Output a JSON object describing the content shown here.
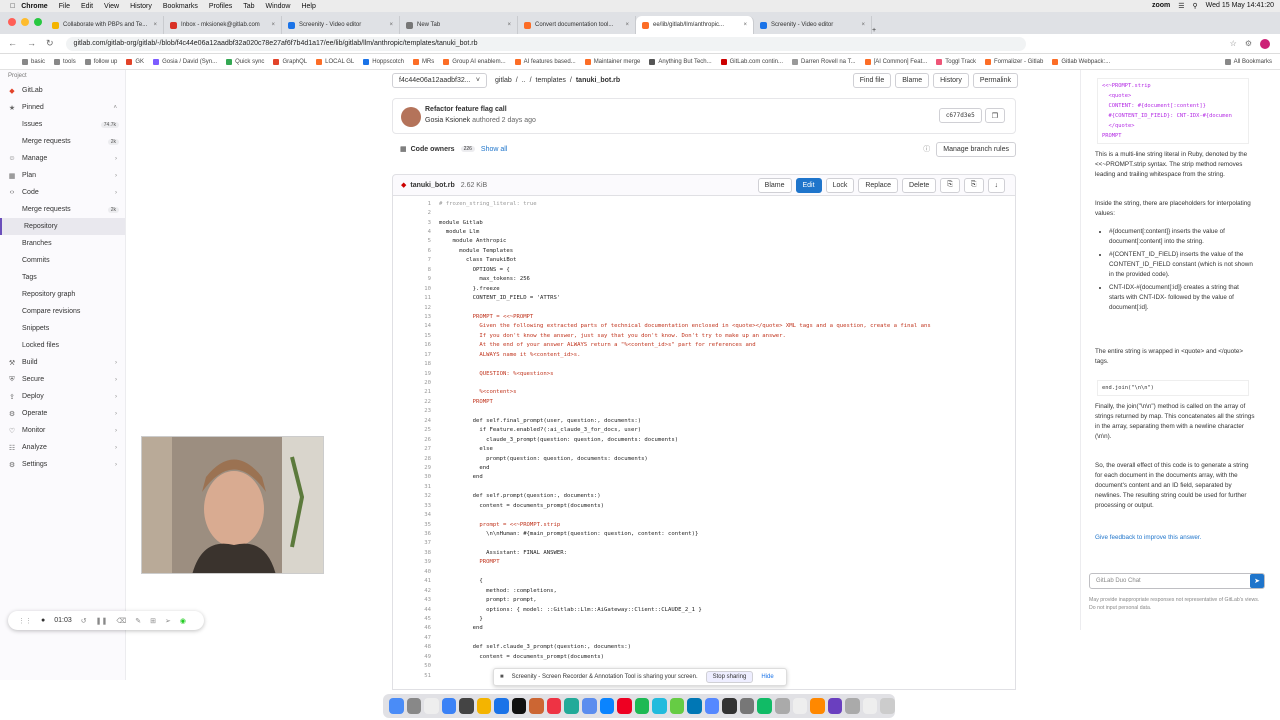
{
  "menubar": {
    "app": "Chrome",
    "items": [
      "File",
      "Edit",
      "View",
      "History",
      "Bookmarks",
      "Profiles",
      "Tab",
      "Window",
      "Help"
    ],
    "zoom_label": "zoom",
    "datetime": "Wed 15 May 14:41:20"
  },
  "tabs": [
    {
      "title": "Collaborate with PBPs and Te...",
      "color": "#f4b400",
      "active": false
    },
    {
      "title": "Inbox - mksionek@gitlab.com",
      "color": "#d93025",
      "active": false
    },
    {
      "title": "Screenity - Video editor",
      "color": "#1a73e8",
      "active": false
    },
    {
      "title": "New Tab",
      "color": "#777777",
      "active": false
    },
    {
      "title": "Convert documentation tool...",
      "color": "#fc6d26",
      "active": false
    },
    {
      "title": "ee/lib/gitlab/llm/anthropic...",
      "color": "#fc6d26",
      "active": true
    },
    {
      "title": "Screenity - Video editor",
      "color": "#1a73e8",
      "active": false
    }
  ],
  "address": {
    "url": "gitlab.com/gitlab-org/gitlab/-/blob/f4c44e06a12aadbf32a020c78e27af6f7b4d1a17/ee/lib/gitlab/llm/anthropic/templates/tanuki_bot.rb"
  },
  "bookmarks": [
    "basic",
    "tools",
    "follow up",
    "GK",
    "Gosia / David (Syn...",
    "Quick sync",
    "GraphQL",
    "LOCAL GL",
    "Hoppscotch",
    "MRs",
    "Group AI enablem...",
    "AI features based...",
    "Maintainer merge",
    "Anything But Tech...",
    "GitLab.com contin...",
    "Darren Rovell na T...",
    "[AI Common] Feat...",
    "Toggl Track",
    "Formalizer - Gitlab",
    "Gitlab Webpack:...",
    "All Bookmarks"
  ],
  "sidebar": {
    "project_label": "Project",
    "project_name": "GitLab",
    "pinned": "Pinned",
    "items": [
      {
        "label": "Issues",
        "count": "74.7k",
        "sub": true
      },
      {
        "label": "Merge requests",
        "count": "2k",
        "sub": true
      },
      {
        "label": "Manage",
        "chev": true
      },
      {
        "label": "Plan",
        "chev": true
      },
      {
        "label": "Code",
        "chev": true
      },
      {
        "label": "Merge requests",
        "count": "2k",
        "sub": true
      },
      {
        "label": "Repository",
        "sub": true,
        "active": true
      },
      {
        "label": "Branches",
        "sub": true
      },
      {
        "label": "Commits",
        "sub": true
      },
      {
        "label": "Tags",
        "sub": true
      },
      {
        "label": "Repository graph",
        "sub": true
      },
      {
        "label": "Compare revisions",
        "sub": true
      },
      {
        "label": "Snippets",
        "sub": true
      },
      {
        "label": "Locked files",
        "sub": true
      },
      {
        "label": "Build",
        "chev": true
      },
      {
        "label": "Secure",
        "chev": true
      },
      {
        "label": "Deploy",
        "chev": true
      },
      {
        "label": "Operate",
        "chev": true
      },
      {
        "label": "Monitor",
        "chev": true
      },
      {
        "label": "Analyze",
        "chev": true
      },
      {
        "label": "Settings",
        "chev": true
      }
    ]
  },
  "breadcrumb": {
    "ref": "f4c44e06a12aadbf32...",
    "path": [
      "gitlab",
      "/",
      "..",
      "/",
      "templates",
      "/",
      "tanuki_bot.rb"
    ],
    "buttons": [
      "Find file",
      "Blame",
      "History",
      "Permalink"
    ]
  },
  "commit": {
    "title": "Refactor feature flag call",
    "author": "Gosia Ksionek",
    "when": "authored 2 days ago",
    "sha": "c677d3e5"
  },
  "owners": {
    "label": "Code owners",
    "count": "226",
    "show_all": "Show all",
    "manage": "Manage branch rules"
  },
  "file": {
    "name": "tanuki_bot.rb",
    "size": "2.62 KiB",
    "buttons": [
      "Blame",
      "Edit",
      "Lock",
      "Replace",
      "Delete"
    ]
  },
  "code_lines": [
    "# frozen_string_literal: true",
    "",
    "module Gitlab",
    "  module Llm",
    "    module Anthropic",
    "      module Templates",
    "        class TanukiBot",
    "          OPTIONS = {",
    "            max_tokens: 256",
    "          }.freeze",
    "          CONTENT_ID_FIELD = 'ATTRS'",
    "",
    "          PROMPT = <<~PROMPT",
    "            Given the following extracted parts of technical documentation enclosed in <quote></quote> XML tags and a question, create a final ans",
    "            If you don't know the answer, just say that you don't know. Don't try to make up an answer.",
    "            At the end of your answer ALWAYS return a \"%<content_id>s\" part for references and",
    "            ALWAYS name it %<content_id>s.",
    "",
    "            QUESTION: %<question>s",
    "",
    "            %<content>s",
    "          PROMPT",
    "",
    "          def self.final_prompt(user, question:, documents:)",
    "            if Feature.enabled?(:ai_claude_3_for_docs, user)",
    "              claude_3_prompt(question: question, documents: documents)",
    "            else",
    "              prompt(question: question, documents: documents)",
    "            end",
    "          end",
    "",
    "          def self.prompt(question:, documents:)",
    "            content = documents_prompt(documents)",
    "",
    "            prompt = <<~PROMPT.strip",
    "              \\n\\nHuman: #{main_prompt(question: question, content: content)}",
    "",
    "              Assistant: FINAL ANSWER:",
    "            PROMPT",
    "",
    "            {",
    "              method: :completions,",
    "              prompt: prompt,",
    "              options: { model: ::Gitlab::Llm::AiGateway::Client::CLAUDE_2_1 }",
    "            }",
    "          end",
    "",
    "          def self.claude_3_prompt(question:, documents:)",
    "            content = documents_prompt(documents)",
    "",
    ""
  ],
  "chat": {
    "code_top": [
      "<<~PROMPT.strip",
      "  <quote>",
      "  CONTENT: #{document[:content]}",
      "  #{CONTENT_ID_FIELD}: CNT-IDX-#{documen",
      "  </quote>",
      "PROMPT"
    ],
    "p1": "This is a multi-line string literal in Ruby, denoted by the <<~PROMPT.strip syntax. The strip method removes leading and trailing whitespace from the string.",
    "p2": "Inside the string, there are placeholders for interpolating values:",
    "bullets": [
      "#{document[:content]} inserts the value of document[:content] into the string.",
      "#{CONTENT_ID_FIELD} inserts the value of the CONTENT_ID_FIELD constant (which is not shown in the provided code).",
      "CNT-IDX-#{document[:id]} creates a string that starts with CNT-IDX- followed by the value of document[:id]."
    ],
    "p3": "The entire string is wrapped in <quote> and </quote> tags.",
    "code_mid": "end.join(\"\\n\\n\")",
    "p4": "Finally, the join(\"\\n\\n\") method is called on the array of strings returned by map. This concatenates all the strings in the array, separating them with a newline character (\\n\\n).",
    "p5": "So, the overall effect of this code is to generate a string for each document in the documents array, with the document's content and an ID field, separated by newlines. The resulting string could be used for further processing or output.",
    "feedback": "Give feedback to improve this answer.",
    "input_placeholder": "GitLab Duo Chat",
    "disclaimer": "May provide inappropriate responses not representative of GitLab's views. Do not input personal data."
  },
  "recorder": {
    "time": "01:03"
  },
  "sharebar": {
    "text": "Screenity - Screen Recorder & Annotation Tool is sharing your screen.",
    "stop": "Stop sharing",
    "hide": "Hide"
  }
}
